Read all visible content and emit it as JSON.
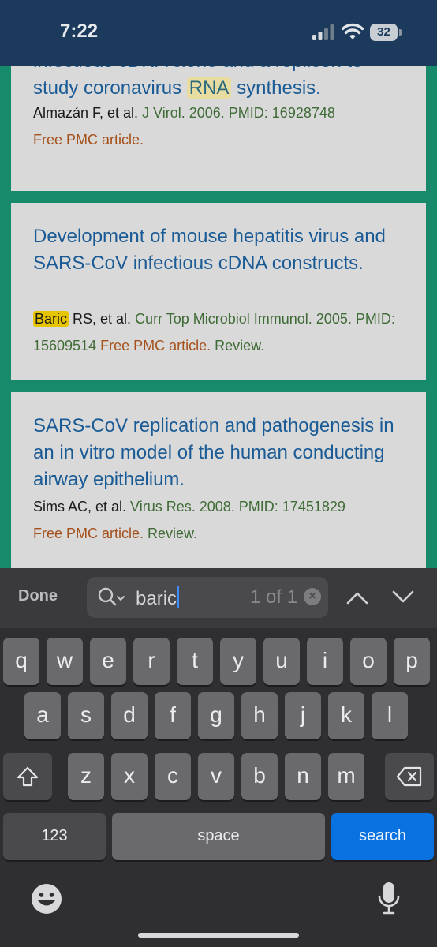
{
  "status_bar": {
    "time": "7:22",
    "battery": "32"
  },
  "articles": [
    {
      "title_before": "infectious cDNA clone and a replicon to study coronavirus ",
      "title_highlight": "RNA",
      "title_after": " synthesis.",
      "authors": "Almazán F, et al. ",
      "journal": "J Virol. 2006. PMID: 16928748",
      "free": "Free PMC article."
    },
    {
      "title": "Development of mouse hepatitis virus and SARS-CoV infectious cDNA constructs.",
      "authors_highlight": "Baric",
      "authors_rest": " RS, et al. ",
      "journal": "Curr Top Microbiol Immunol. 2005. PMID: 15609514 ",
      "free": "Free PMC article.",
      "review": " Review."
    },
    {
      "title": "SARS-CoV replication and pathogenesis in an in vitro model of the human conducting airway epithelium.",
      "authors": "Sims AC, et al. ",
      "journal": "Virus Res. 2008. PMID: 17451829",
      "free": "Free PMC article.",
      "review": " Review."
    }
  ],
  "find_bar": {
    "done_label": "Done",
    "query": "baric",
    "count": "1 of 1"
  },
  "keyboard": {
    "row1": [
      "q",
      "w",
      "e",
      "r",
      "t",
      "y",
      "u",
      "i",
      "o",
      "p"
    ],
    "row2": [
      "a",
      "s",
      "d",
      "f",
      "g",
      "h",
      "j",
      "k",
      "l"
    ],
    "row3": [
      "z",
      "x",
      "c",
      "v",
      "b",
      "n",
      "m"
    ],
    "numbers_label": "123",
    "space_label": "space",
    "search_label": "search"
  },
  "colors": {
    "status_bar": "#1b3a5c",
    "page_background": "#178a6c",
    "card": "#d9d9d9",
    "link": "#1a5b95",
    "search_key": "#0a72e0",
    "highlight": "#e7c400"
  }
}
